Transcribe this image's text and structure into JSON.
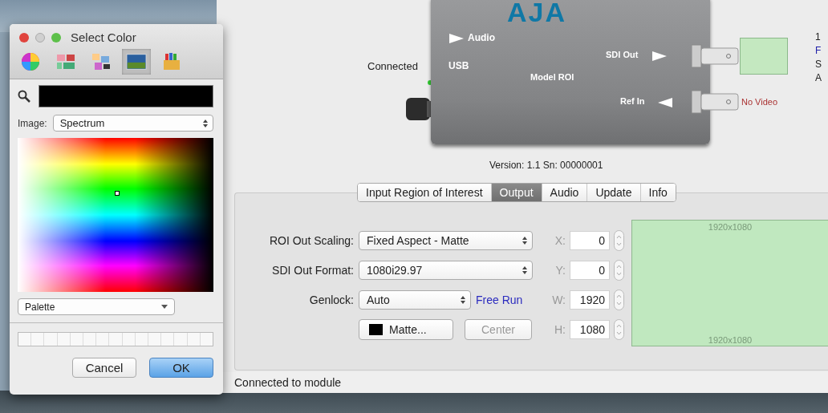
{
  "color_panel": {
    "title": "Select Color",
    "modes": [
      {
        "kind": "wheel",
        "selected": false
      },
      {
        "kind": "sliders",
        "selected": false
      },
      {
        "kind": "palettes",
        "selected": false
      },
      {
        "kind": "image",
        "selected": true
      },
      {
        "kind": "crayons",
        "selected": false
      }
    ],
    "image_label": "Image:",
    "image_select": "Spectrum",
    "palette_select": "Palette",
    "buttons": [
      {
        "label": "Cancel",
        "default": false
      },
      {
        "label": "OK",
        "default": true
      }
    ]
  },
  "device": {
    "logo": "AJA",
    "audio": "Audio",
    "usb": "USB",
    "model": "Model ROI",
    "sdi_out": "SDI Out",
    "ref_in": "Ref In",
    "connection": "Connected",
    "ref_status": "No Video",
    "side_text": [
      "1",
      "F",
      "S",
      "A"
    ]
  },
  "version": "Version: 1.1  Sn: 00000001",
  "tabs": [
    {
      "label": "Input Region of Interest",
      "selected": false
    },
    {
      "label": "Output",
      "selected": true
    },
    {
      "label": "Audio",
      "selected": false
    },
    {
      "label": "Update",
      "selected": false
    },
    {
      "label": "Info",
      "selected": false
    }
  ],
  "output": {
    "rows": [
      {
        "label": "ROI Out Scaling:",
        "value": "Fixed Aspect - Matte",
        "kind": "wide"
      },
      {
        "label": "SDI Out Format:",
        "value": "1080i29.97",
        "kind": "wide"
      },
      {
        "label": "Genlock:",
        "value": "Auto",
        "kind": "genlock",
        "status": "Free Run"
      }
    ],
    "matte_button": "Matte...",
    "center_button": {
      "label": "Center",
      "disabled": true
    },
    "coords": [
      {
        "label": "X:",
        "value": "0"
      },
      {
        "label": "Y:",
        "value": "0"
      },
      {
        "label": "W:",
        "value": "1920"
      },
      {
        "label": "H:",
        "value": "1080"
      }
    ],
    "preview_top": "1920x1080",
    "preview_bottom": "1920x1080"
  },
  "status_bar": "Connected to module"
}
